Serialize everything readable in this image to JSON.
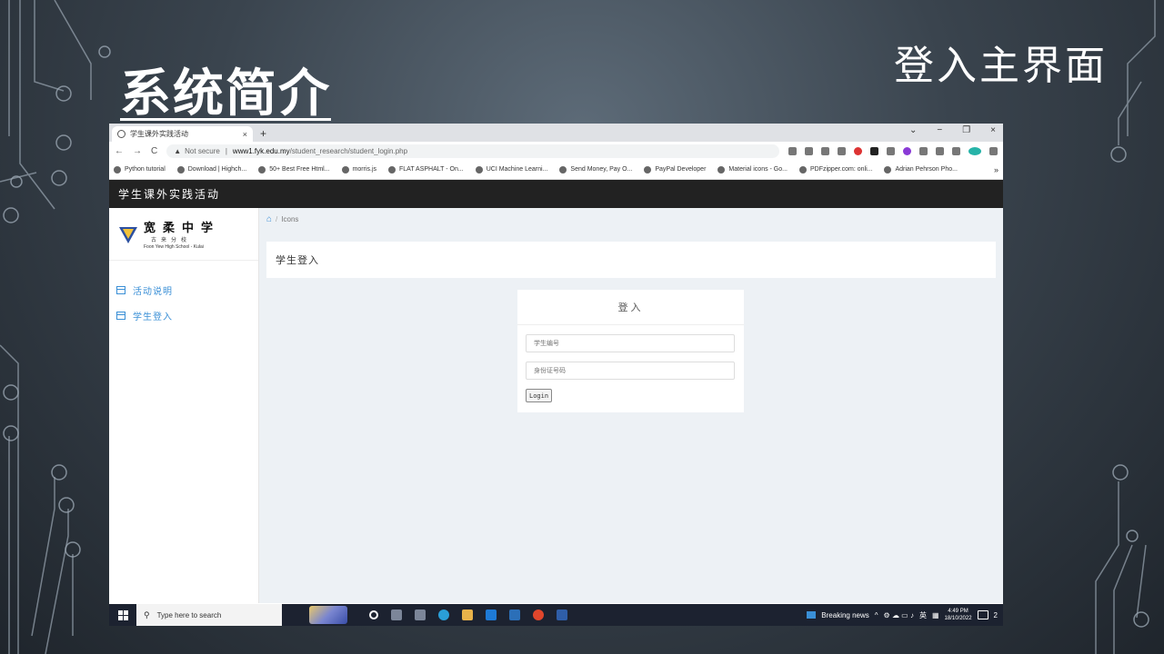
{
  "slide": {
    "title": "系统简介",
    "subtitle": "登入主界面"
  },
  "browser": {
    "tab_title": "学生课外实践活动",
    "tab_close": "×",
    "new_tab": "+",
    "win_min": "−",
    "win_max": "❐",
    "win_close": "×",
    "win_dropdown": "⌄",
    "back": "←",
    "forward": "→",
    "reload": "C",
    "warning": "▲",
    "not_secure": "Not secure",
    "url_sep": "|",
    "url_host": "www1.fyk.edu.my",
    "url_path": "/student_research/student_login.php",
    "bookmarks": [
      "Python tutorial",
      "Download | Highch...",
      "50+ Best Free Html...",
      "morris.js",
      "FLAT ASPHALT - On...",
      "UCI Machine Learni...",
      "Send Money, Pay O...",
      "PayPal Developer",
      "Material icons - Go...",
      "PDFzipper.com: onli...",
      "Adrian Pehrson Pho..."
    ],
    "bookmarks_more": "»"
  },
  "app": {
    "header_title": "学生课外实践活动",
    "logo_cn": "宽柔中学",
    "logo_cn2": "古来分校",
    "logo_en": "Foon Yew High School - Kulai",
    "menu": [
      {
        "label": "活动说明"
      },
      {
        "label": "学生登入"
      }
    ],
    "breadcrumb_sep": "/",
    "breadcrumb": "Icons",
    "page_title": "学生登入",
    "login": {
      "heading": "登入",
      "student_id_placeholder": "学生编号",
      "id_number_placeholder": "身份证号码",
      "button": "Login"
    }
  },
  "taskbar": {
    "search_placeholder": "Type here to search",
    "news": "Breaking news",
    "lang": "英",
    "time": "4:49 PM",
    "date": "18/10/2022",
    "tray_arrow": "^",
    "notification_count": "2"
  }
}
